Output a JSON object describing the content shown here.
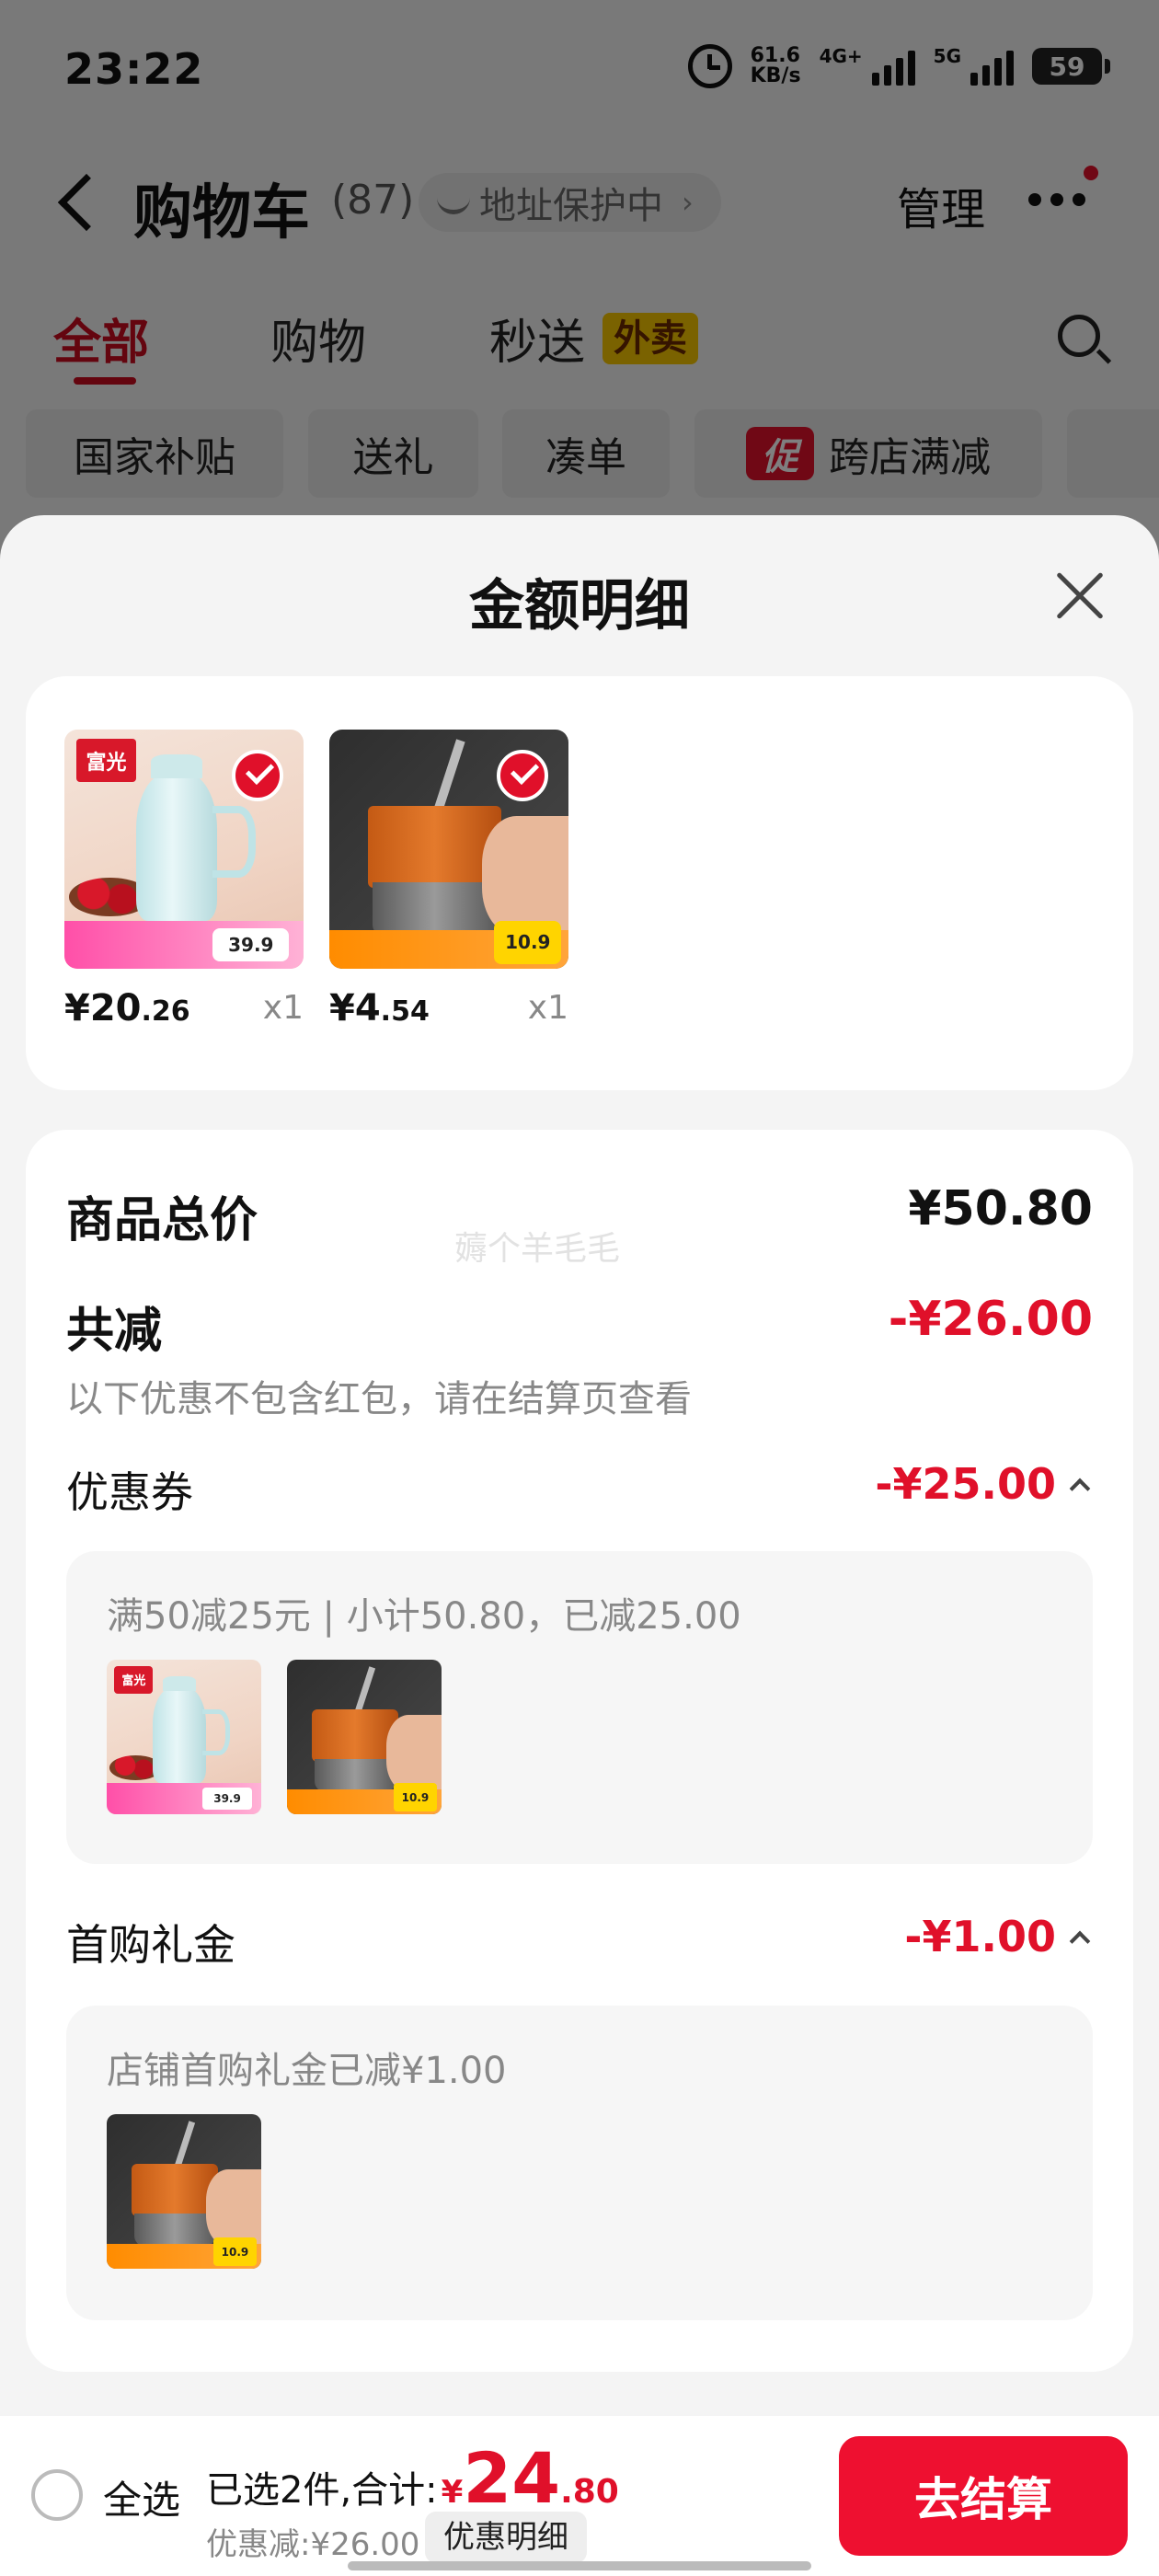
{
  "status_bar": {
    "time": "23:22",
    "net_speed_value": "61.6",
    "net_speed_unit": "KB/s",
    "net_4g_label": "4G+",
    "net_5g_label": "5G",
    "battery": "59",
    "icons": [
      "alarm-icon",
      "signal-icon",
      "battery-icon"
    ]
  },
  "nav": {
    "title": "购物车",
    "count": "(87)",
    "address_protection": "地址保护中",
    "manage": "管理"
  },
  "tabs": [
    {
      "label": "全部",
      "active": true
    },
    {
      "label": "购物",
      "active": false
    },
    {
      "label": "秒送",
      "active": false
    }
  ],
  "tab_badge": "外卖",
  "filter_chips": [
    {
      "label": "国家补贴"
    },
    {
      "label": "送礼"
    },
    {
      "label": "凑单"
    },
    {
      "label": "跨店满减",
      "icon_text": "促"
    }
  ],
  "sheet": {
    "title": "金额明细",
    "products": [
      {
        "name": "thermos",
        "thumb_logo": "富光",
        "thumb_price": "39.9",
        "price_int": "¥20",
        "price_dec": ".26",
        "qty": "x1",
        "checked": true
      },
      {
        "name": "cup",
        "thumb_price": "10.9",
        "price_int": "¥4",
        "price_dec": ".54",
        "qty": "x1",
        "checked": true
      }
    ],
    "summary": {
      "total_label": "商品总价",
      "total_value": "¥50.80",
      "watermark": "薅个羊毛毛",
      "reduce_label": "共减",
      "reduce_value": "-¥26.00",
      "reduce_note": "以下优惠不包含红包，请在结算页查看",
      "coupon": {
        "label": "优惠券",
        "value": "-¥25.00",
        "detail": "满50减25元 | 小计50.80，已减25.00"
      },
      "first_gift": {
        "label": "首购礼金",
        "value": "-¥1.00",
        "detail": "店铺首购礼金已减¥1.00"
      }
    }
  },
  "bottom_bar": {
    "select_all": "全选",
    "selected_text": "已选2件,合计:",
    "currency": "¥",
    "total_int": "24",
    "total_dec": ".80",
    "discount_text": "优惠减:¥26.00",
    "detail_link": "优惠明细",
    "checkout": "去结算"
  },
  "colors": {
    "accent_red": "#e0102a",
    "checkout_red": "#ee1030",
    "takeout_yellow": "#f5c400"
  }
}
